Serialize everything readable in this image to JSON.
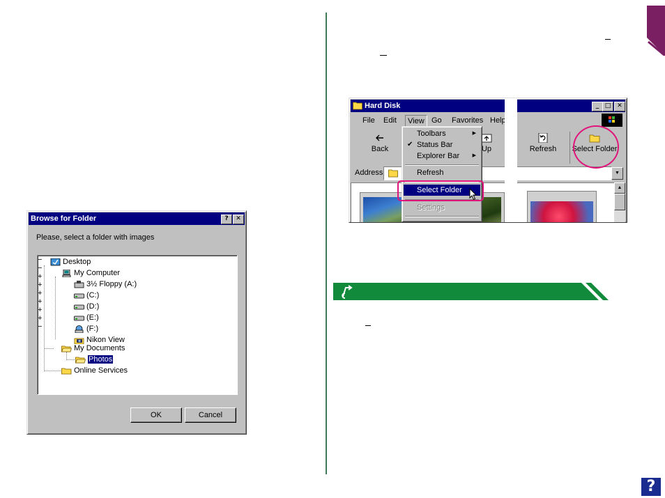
{
  "browse_dialog": {
    "title": "Browse for Folder",
    "help_glyph": "?",
    "close_glyph": "✕",
    "prompt": "Please, select a folder with images",
    "tree": [
      {
        "label": "Desktop",
        "icon": "desktop-icon",
        "expander": "−"
      },
      {
        "label": "My Computer",
        "icon": "computer-icon",
        "expander": "−"
      },
      {
        "label": "3½ Floppy (A:)",
        "icon": "floppy-drive-icon",
        "expander": "+"
      },
      {
        "label": "(C:)",
        "icon": "hard-drive-icon",
        "expander": "+"
      },
      {
        "label": "(D:)",
        "icon": "hard-drive-icon",
        "expander": "+"
      },
      {
        "label": "(E:)",
        "icon": "hard-drive-icon",
        "expander": "+"
      },
      {
        "label": "(F:)",
        "icon": "network-drive-icon",
        "expander": "+"
      },
      {
        "label": "Nikon View",
        "icon": "camera-folder-icon",
        "expander": "+"
      },
      {
        "label": "My Documents",
        "icon": "open-folder-icon",
        "expander": "−"
      },
      {
        "label": "Photos",
        "icon": "open-folder-icon",
        "selected": true
      },
      {
        "label": "Online Services",
        "icon": "folder-icon"
      }
    ],
    "ok_label": "OK",
    "cancel_label": "Cancel"
  },
  "explorer": {
    "title": "Hard Disk",
    "window_buttons": [
      "_",
      "□",
      "✕"
    ],
    "menu": [
      "File",
      "Edit",
      "View",
      "Go",
      "Favorites",
      "Help"
    ],
    "toolbar": {
      "back_label": "Back",
      "up_label": "Up",
      "refresh_label": "Refresh",
      "select_folder_label": "Select Folder"
    },
    "address_label": "Address",
    "view_menu": {
      "toolbars": "Toolbars",
      "status_bar": "Status Bar",
      "explorer_bar": "Explorer Bar",
      "refresh": "Refresh",
      "select_folder": "Select Folder",
      "settings": "Settings",
      "check_glyph": "✔",
      "submenu_arrow": "▶"
    }
  },
  "help_button": "?",
  "colors": {
    "accent_green": "#128a3c",
    "highlight_pink": "#e0147a",
    "title_blue": "#000080",
    "help_blue": "#1a2c8f"
  }
}
